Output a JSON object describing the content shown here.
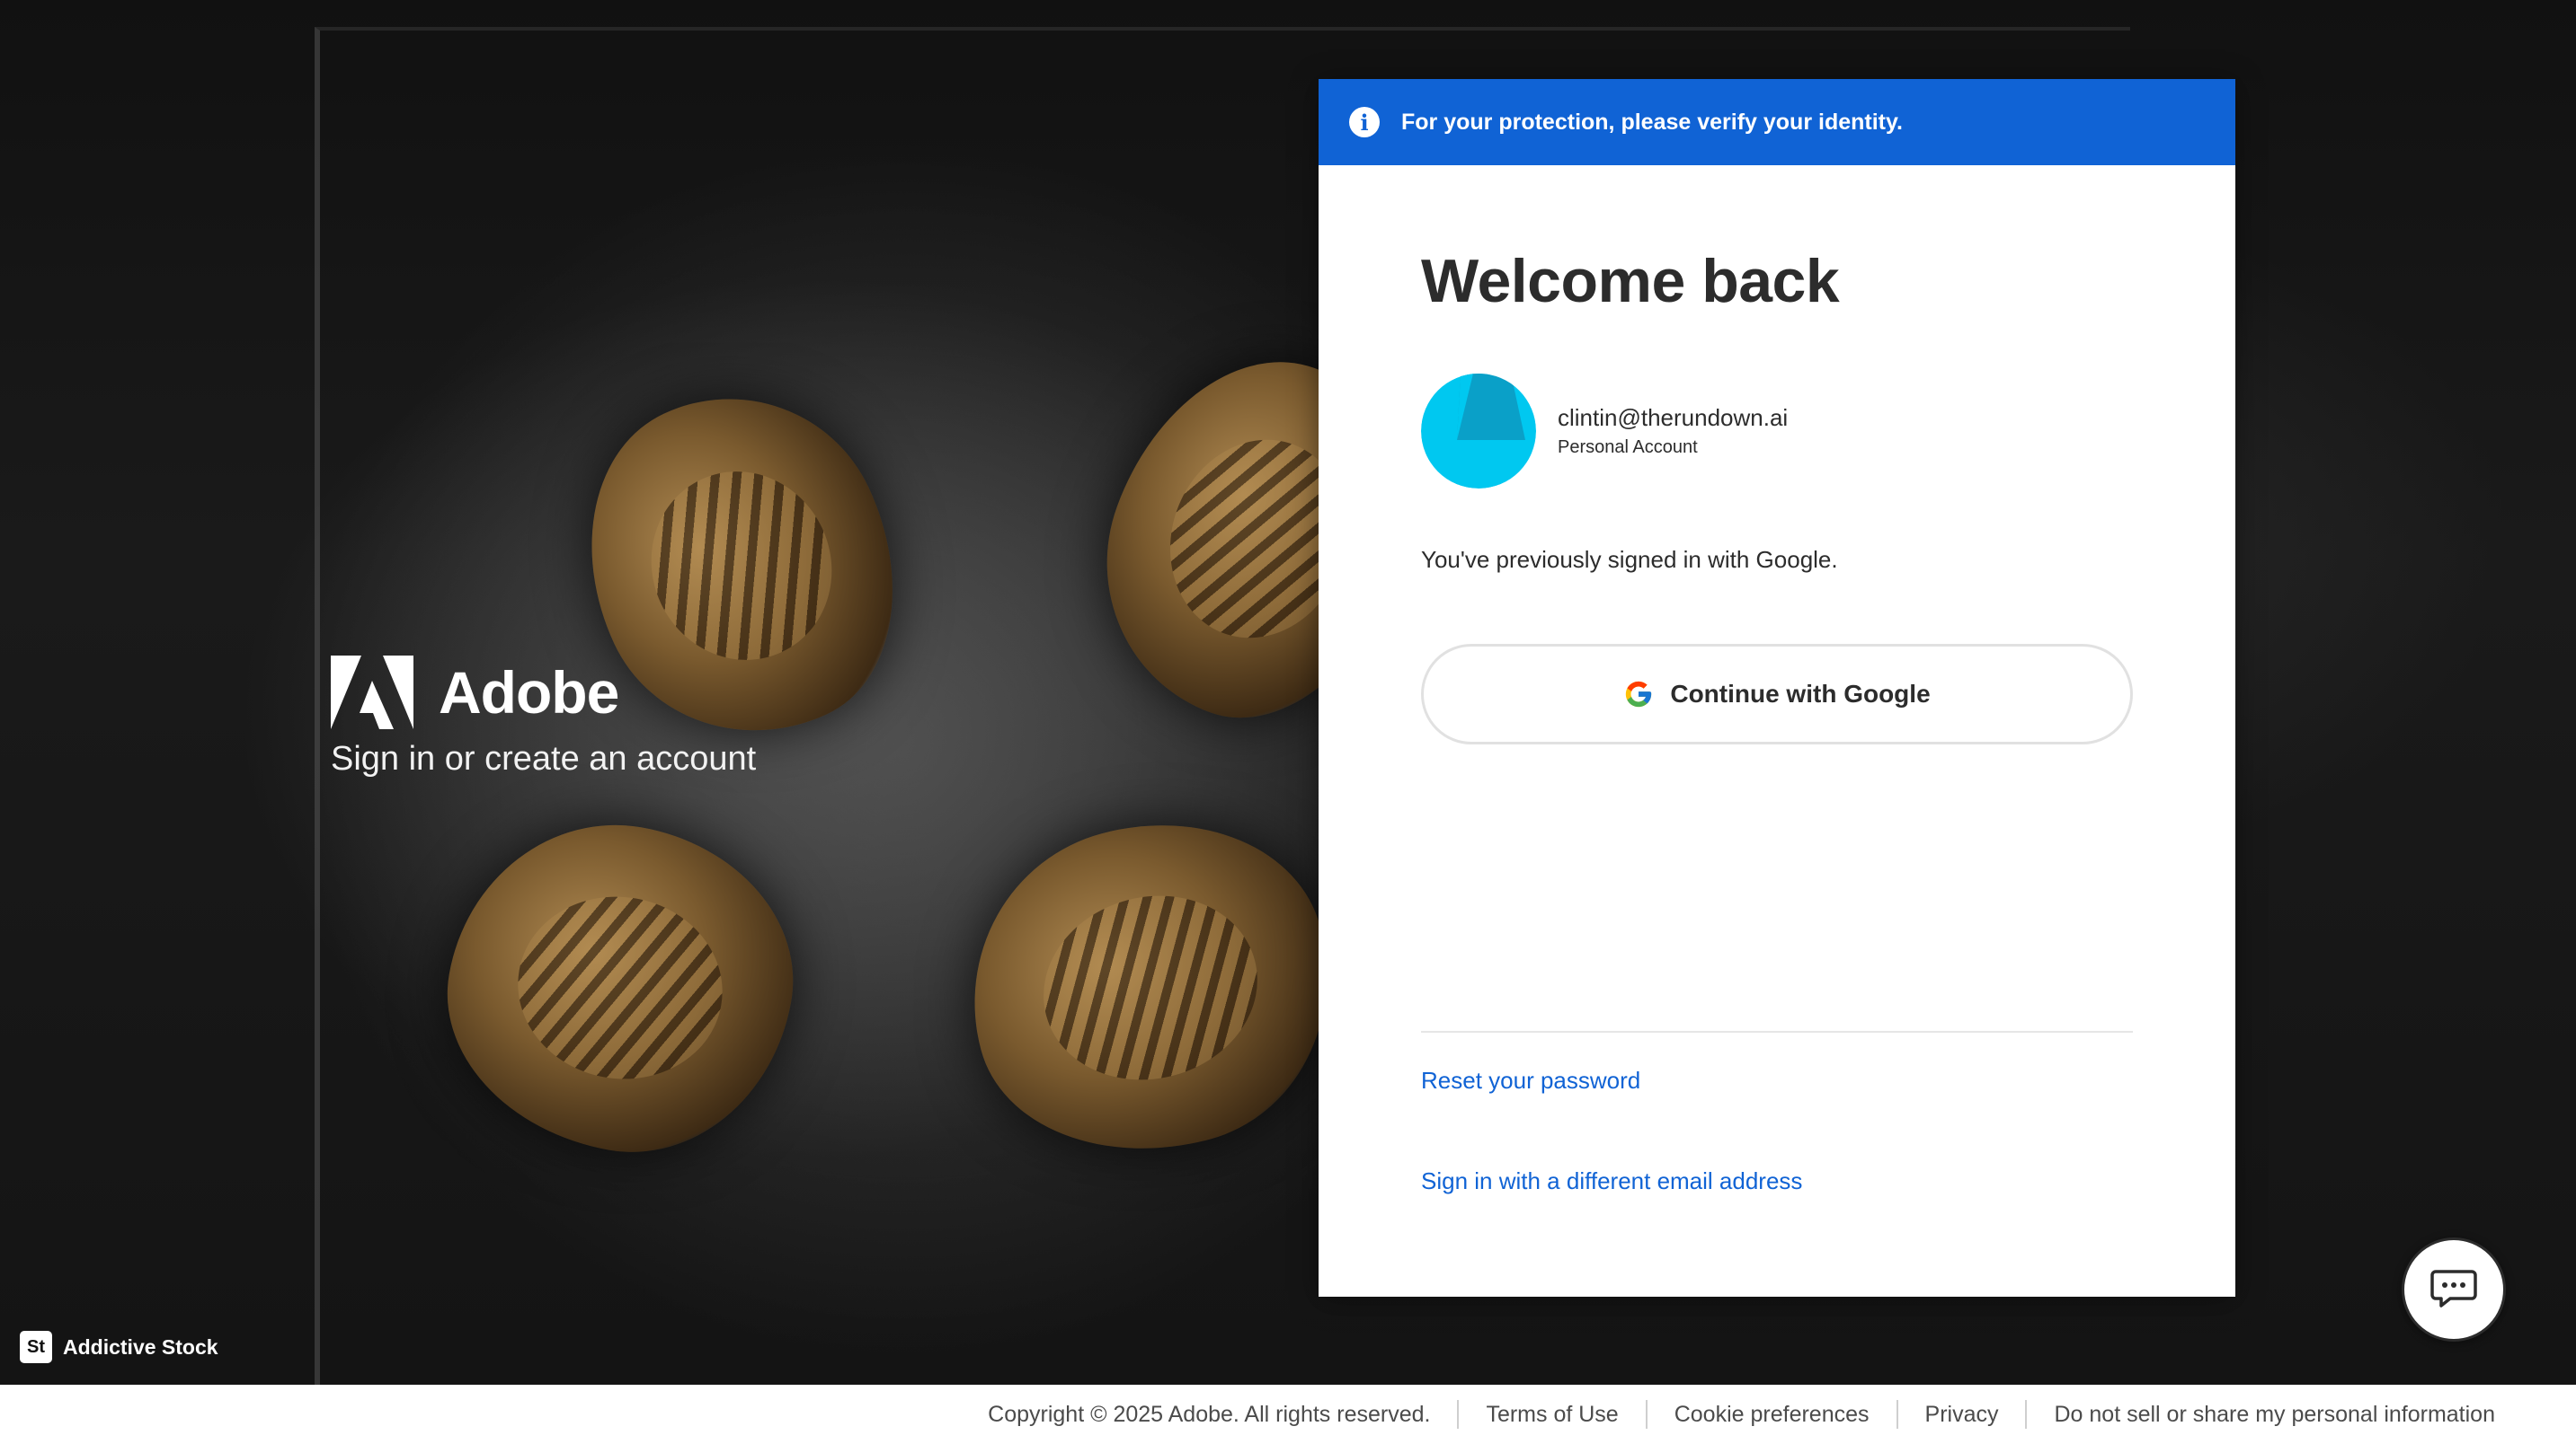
{
  "banner": {
    "text": "For your protection, please verify your identity.",
    "icon": "info-icon"
  },
  "brand": {
    "name": "Adobe",
    "tagline": "Sign in or create an account"
  },
  "stock_credit": {
    "badge": "St",
    "text": "Addictive Stock"
  },
  "card": {
    "title": "Welcome back",
    "account": {
      "email": "clintin@therundown.ai",
      "type": "Personal Account"
    },
    "previous_signin": "You've previously signed in with Google.",
    "google_button": "Continue with Google",
    "reset_link": "Reset your password",
    "different_email_link": "Sign in with a different email address"
  },
  "footer": {
    "copyright": "Copyright © 2025 Adobe. All rights reserved.",
    "terms": "Terms of Use",
    "cookies": "Cookie preferences",
    "privacy": "Privacy",
    "do_not_sell": "Do not sell or share my personal information"
  },
  "colors": {
    "accent_blue": "#1063d5",
    "avatar_cyan": "#00c8f0",
    "avatar_dark": "#0aa0c8"
  }
}
